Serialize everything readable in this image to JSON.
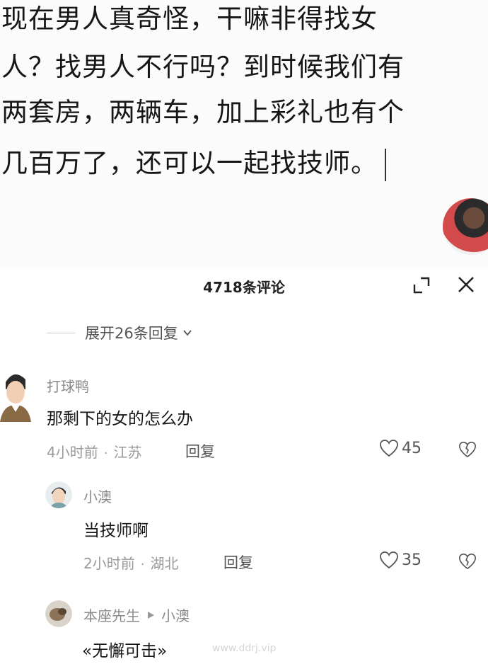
{
  "post": {
    "lines": [
      "现在男人真奇怪，干嘛非得找女",
      "人？找男人不行吗？到时候我们有",
      "两套房，两辆车，加上彩礼也有个",
      "几百万了，还可以一起找技师。"
    ]
  },
  "comments_header": {
    "count_label": "4718条评论"
  },
  "expand": {
    "label": "展开26条回复"
  },
  "comments": [
    {
      "user": "打球鸭",
      "text": "那剩下的女的怎么办",
      "time": "4小时前",
      "location": "江苏",
      "reply": "回复",
      "likes": "45"
    },
    {
      "user": "小澳",
      "text": "当技师啊",
      "time": "2小时前",
      "location": "湖北",
      "reply": "回复",
      "likes": "35"
    },
    {
      "user": "本座先生",
      "reply_to": "小澳",
      "text": "«无懈可击»"
    }
  ],
  "meta_separator": "·",
  "watermark": "www.ddrj.vip"
}
